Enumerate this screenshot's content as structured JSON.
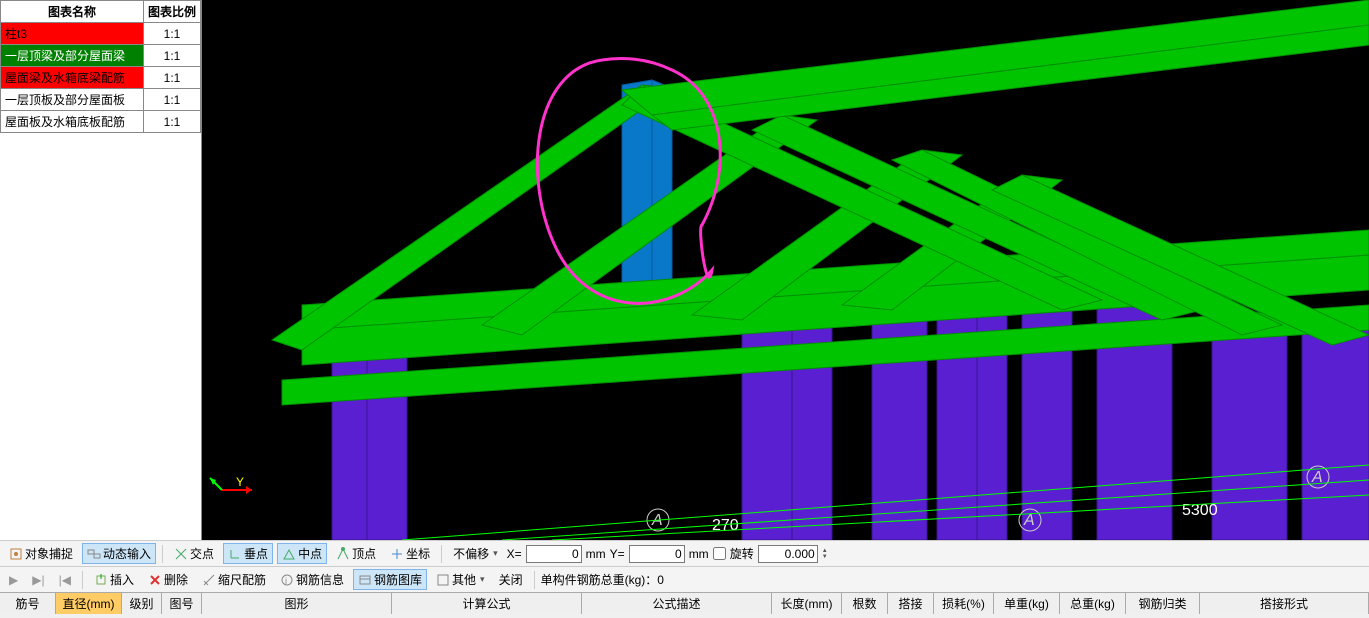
{
  "side_table": {
    "header1": "图表名称",
    "header2": "图表比例",
    "rows": [
      {
        "name": "柱t3",
        "ratio": "1:1",
        "cls": "row-red"
      },
      {
        "name": "一层顶梁及部分屋面梁",
        "ratio": "1:1",
        "cls": "row-green"
      },
      {
        "name": "屋面梁及水箱底梁配筋",
        "ratio": "1:1",
        "cls": "row-red"
      },
      {
        "name": "一层顶板及部分屋面板",
        "ratio": "1:1",
        "cls": "row-white"
      },
      {
        "name": "屋面板及水箱底板配筋",
        "ratio": "1:1",
        "cls": "row-white"
      }
    ]
  },
  "viewport": {
    "labels": {
      "A1": "A",
      "A2": "A",
      "A3": "A",
      "dim1": "270",
      "dim2": "5300"
    }
  },
  "snap_bar": {
    "obj_snap": "对象捕捉",
    "dyn_input": "动态输入",
    "cross": "交点",
    "perp": "垂点",
    "mid": "中点",
    "top": "顶点",
    "coord": "坐标",
    "offset_sel": "不偏移",
    "x_label": "X=",
    "x_val": "0",
    "mm1": "mm",
    "y_label": "Y=",
    "y_val": "0",
    "mm2": "mm",
    "rotate": "旋转",
    "rot_val": "0.000"
  },
  "edit_bar": {
    "insert": "插入",
    "delete": "删除",
    "scale_rebar": "缩尺配筋",
    "rebar_info": "钢筋信息",
    "rebar_lib": "钢筋图库",
    "other": "其他",
    "close": "关闭",
    "weight_label": "单构件钢筋总重(kg)：0"
  },
  "cols": {
    "c_no": "筋号",
    "c_dia": "直径(mm)",
    "c_grade": "级别",
    "c_imgno": "图号",
    "c_shape": "图形",
    "c_formula": "计算公式",
    "c_desc": "公式描述",
    "c_len": "长度(mm)",
    "c_count": "根数",
    "c_lap": "搭接",
    "c_loss": "损耗(%)",
    "c_unitw": "单重(kg)",
    "c_totalw": "总重(kg)",
    "c_class": "钢筋归类",
    "c_lapform": "搭接形式"
  }
}
